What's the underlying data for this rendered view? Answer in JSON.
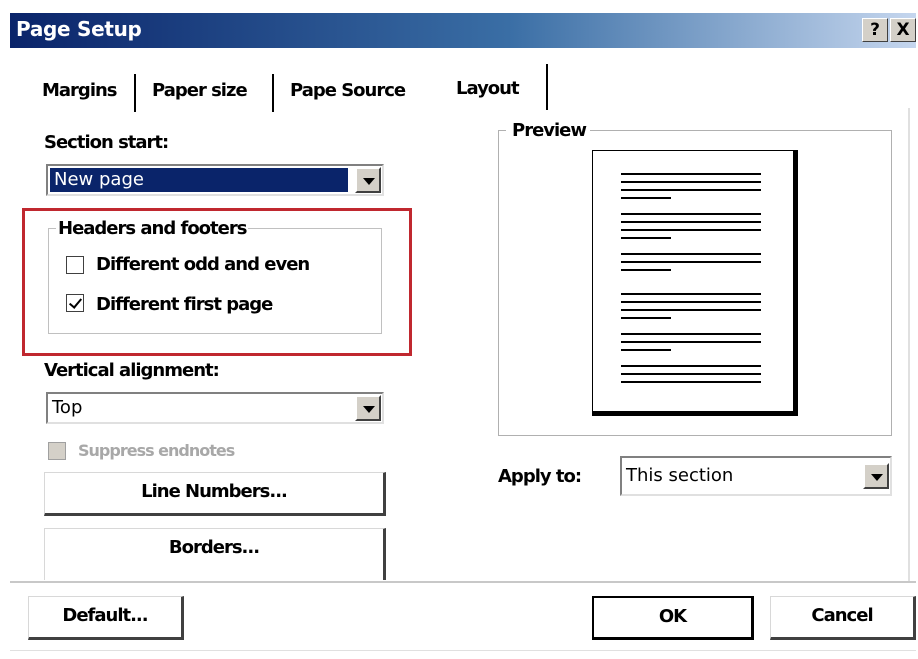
{
  "window": {
    "title": "Page Setup",
    "help_label": "?",
    "close_label": "X"
  },
  "tabs": [
    {
      "label": "Margins"
    },
    {
      "label": "Paper size"
    },
    {
      "label": "Pape Source"
    },
    {
      "label": "Layout",
      "active": true
    }
  ],
  "section_start": {
    "label": "Section start:",
    "value": "New page"
  },
  "headers_footers": {
    "title": "Headers and footers",
    "odd_even": {
      "label": "Different odd and even",
      "checked": false
    },
    "first_page": {
      "label": "Different first page",
      "checked": true
    }
  },
  "vertical_alignment": {
    "label": "Vertical alignment:",
    "value": "Top"
  },
  "suppress_endnotes": {
    "label": "Suppress endnotes",
    "checked": false,
    "disabled": true
  },
  "buttons": {
    "line_numbers": "Line Numbers...",
    "borders": "Borders...",
    "default": "Default...",
    "ok": "OK",
    "cancel": "Cancel"
  },
  "preview": {
    "title": "Preview"
  },
  "apply_to": {
    "label": "Apply to:",
    "value": "This section"
  },
  "colors": {
    "title_bar_start": "#0a246a",
    "highlight_box": "#c0282f",
    "selection": "#0a246a"
  }
}
